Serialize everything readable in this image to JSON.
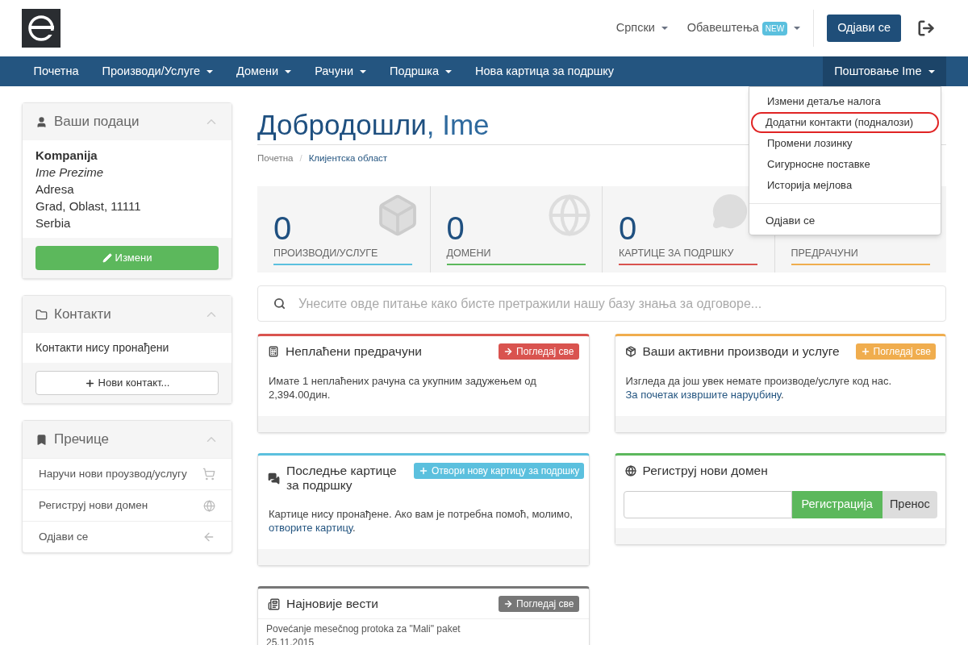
{
  "header": {
    "language": "Српски",
    "notifications": {
      "label": "Обавештења",
      "badge": "NEW"
    },
    "logout_button": "Одјави се"
  },
  "nav": {
    "items": [
      {
        "label": "Почетна",
        "dropdown": false
      },
      {
        "label": "Производи/Услуге",
        "dropdown": true
      },
      {
        "label": "Домени",
        "dropdown": true
      },
      {
        "label": "Рачуни",
        "dropdown": true
      },
      {
        "label": "Подршка",
        "dropdown": true
      },
      {
        "label": "Нова картица за подршку",
        "dropdown": false
      }
    ],
    "account": {
      "label": "Поштовање Ime",
      "expanded": true
    }
  },
  "account_menu": {
    "items": [
      {
        "label": "Измени детаље налога",
        "circled": false
      },
      {
        "label": "Додатни контакти (подналози)",
        "circled": true
      },
      {
        "label": "Промени лозинку",
        "circled": false
      },
      {
        "label": "Сигурносне поставке",
        "circled": false
      },
      {
        "label": "Историја мејлова",
        "circled": false
      }
    ],
    "logout": "Одјави се"
  },
  "sidebar": {
    "your_info": {
      "title": "Ваши подаци",
      "company": "Kompanija",
      "name": "Ime Prezime",
      "address": "Adresa",
      "city": "Grad, Oblast, 11111",
      "country": "Serbia",
      "button": "Измени"
    },
    "contacts": {
      "title": "Контакти",
      "empty": "Контакти нису пронађени",
      "button": "Нови контакт..."
    },
    "shortcuts": {
      "title": "Пречице",
      "items": [
        {
          "label": "Наручи нови проузвод/услугу",
          "kind": "cart"
        },
        {
          "label": "Региструј нови домен",
          "kind": "globe"
        },
        {
          "label": "Одјави се",
          "kind": "back"
        }
      ]
    }
  },
  "page": {
    "title": "Добродошли",
    "name": ", Ime",
    "breadcrumb_separator": "/",
    "breadcrumb": [
      {
        "label": "Почетна",
        "selected": false
      },
      {
        "label": "Клијентска област",
        "selected": true
      }
    ]
  },
  "stats": [
    {
      "value": "0",
      "label": "ПРОИЗВОДИ/УСЛУГЕ",
      "color": "#5bc0de",
      "kind": "box"
    },
    {
      "value": "0",
      "label": "ДОМЕНИ",
      "color": "#5cb85c",
      "kind": "globe"
    },
    {
      "value": "0",
      "label": "КАРТИЦЕ ЗА ПОДРШКУ",
      "color": "#d9534f",
      "kind": "chat"
    },
    {
      "label": "ПРЕДРАЧУНИ",
      "color": "#f0ad4e",
      "kind": "none"
    }
  ],
  "search": {
    "placeholder": "Унесите овде питање како бисте претражили нашу базу знања за одговоре..."
  },
  "panels": [
    {
      "kind": "invoices",
      "title": "Неплаћени предрачуни",
      "color": "#d9534f",
      "button": {
        "label": "Погледај све",
        "kind": "arrow"
      },
      "text": "Имате 1 неплаћених рачуна са укупним задужењем од 2,394.00дин."
    },
    {
      "kind": "products",
      "title": "Ваши активни производи и услуге",
      "color": "#f0ad4e",
      "button": {
        "label": "Погледај све",
        "kind": "plus"
      },
      "text": "Изгледа да још увек немате производе/услуге код нас. ",
      "link": "За почетак извршите наруџбину",
      "after": "."
    },
    {
      "kind": "tickets",
      "title": "Последње картице за подршку",
      "color": "#5bc0de",
      "button": {
        "label": "Отвори нову картицу за подршку",
        "kind": "plus"
      },
      "text": "Картице нису пронађене. Ако вам је потребна помоћ, молимо, ",
      "link": "отворите картицу",
      "after": "."
    },
    {
      "kind": "domain",
      "title": "Региструј нови домен",
      "color": "#5cb85c",
      "register": "Регистрација",
      "transfer": "Пренос"
    },
    {
      "kind": "news",
      "title": "Најновије вести",
      "color": "#777777",
      "button": {
        "label": "Погледај све",
        "kind": "arrow"
      },
      "news_title": "Povećanje mesečnog protoka za \"Mali\" paket",
      "date": "25.11.2015"
    }
  ]
}
